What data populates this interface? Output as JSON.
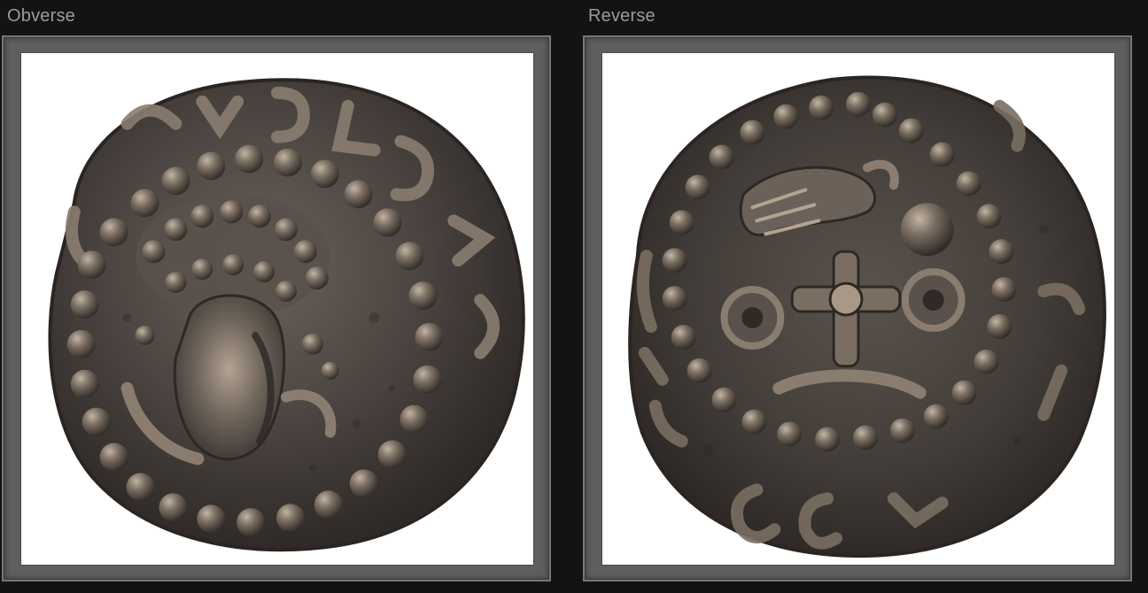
{
  "panels": [
    {
      "label": "Obverse",
      "image_subject": "coin-obverse-bust"
    },
    {
      "label": "Reverse",
      "image_subject": "coin-reverse-cross-bird"
    }
  ],
  "colors": {
    "background": "#131313",
    "frame": "#5f5f5f",
    "frame_border": "#777777",
    "label_text": "#9a9a9a",
    "image_bg": "#ffffff",
    "coin_dark": "#3f3a37",
    "coin_mid": "#5c544e",
    "coin_light": "#8a7d70",
    "coin_highlight": "#b8a995"
  }
}
